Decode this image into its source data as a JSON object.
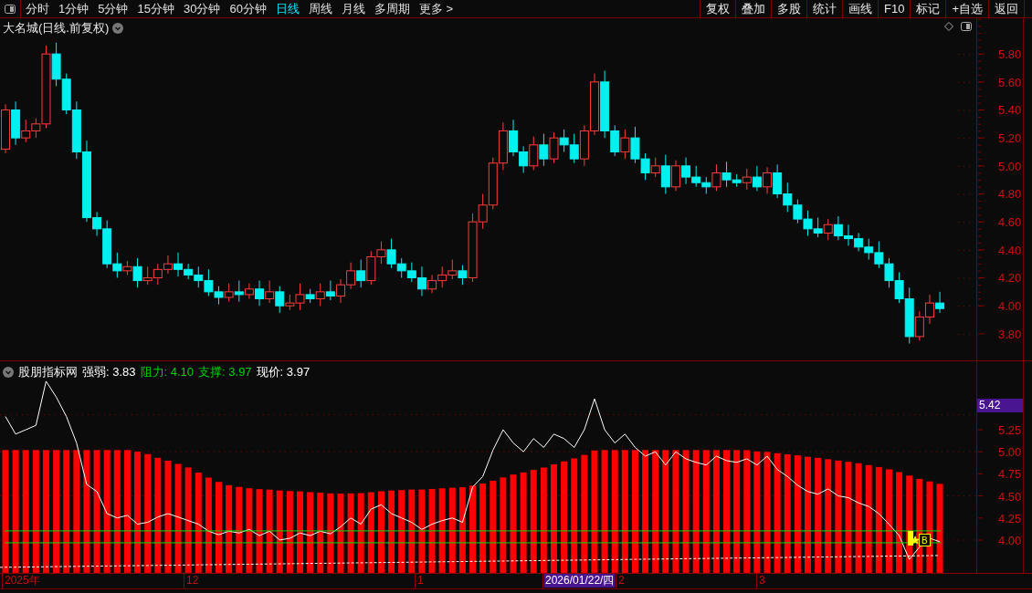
{
  "toolbar": {
    "periods": [
      {
        "label": "分时",
        "selected": false
      },
      {
        "label": "1分钟",
        "selected": false
      },
      {
        "label": "5分钟",
        "selected": false
      },
      {
        "label": "15分钟",
        "selected": false
      },
      {
        "label": "30分钟",
        "selected": false
      },
      {
        "label": "60分钟",
        "selected": false
      },
      {
        "label": "日线",
        "selected": true
      },
      {
        "label": "周线",
        "selected": false
      },
      {
        "label": "月线",
        "selected": false
      },
      {
        "label": "多周期",
        "selected": false
      }
    ],
    "more": "更多 >",
    "buttons": [
      "复权",
      "叠加",
      "多股",
      "统计",
      "画线",
      "F10",
      "标记",
      "+自选",
      "返回"
    ]
  },
  "main_chart": {
    "title": "大名城(日线.前复权)",
    "price_ticks": [
      "5.80",
      "5.60",
      "5.40",
      "5.20",
      "5.00",
      "4.80",
      "4.60",
      "4.40",
      "4.20",
      "4.00",
      "3.80"
    ]
  },
  "indicator": {
    "name": "股朋指标网",
    "readings": [
      {
        "label": "强弱: 3.83",
        "color": "#ffffff"
      },
      {
        "label": "阻力: 4.10",
        "color": "#00d200"
      },
      {
        "label": "支撑: 3.97",
        "color": "#00d200"
      },
      {
        "label": "现价: 3.97",
        "color": "#ffffff"
      }
    ],
    "current_value": "5.42",
    "ticks": [
      "5.25",
      "5.00",
      "4.75",
      "4.50",
      "4.25",
      "4.00"
    ],
    "signal": "B"
  },
  "date_axis": {
    "labels": [
      {
        "label": "2025年",
        "selected": false
      },
      {
        "label": "12",
        "selected": false
      },
      {
        "label": "1",
        "selected": false
      },
      {
        "label": "2026/01/22/四",
        "selected": true
      },
      {
        "label": "2",
        "selected": false
      },
      {
        "label": "3",
        "selected": false
      }
    ]
  }
}
